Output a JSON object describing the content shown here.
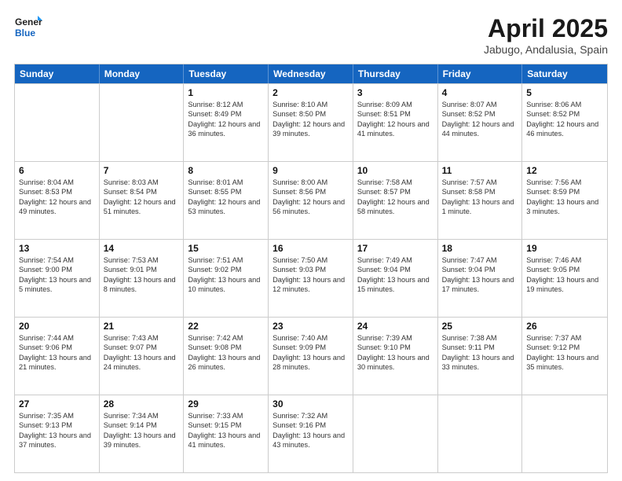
{
  "logo": {
    "line1": "General",
    "line2": "Blue"
  },
  "title": "April 2025",
  "subtitle": "Jabugo, Andalusia, Spain",
  "days": [
    "Sunday",
    "Monday",
    "Tuesday",
    "Wednesday",
    "Thursday",
    "Friday",
    "Saturday"
  ],
  "weeks": [
    [
      {
        "day": "",
        "sunrise": "",
        "sunset": "",
        "daylight": ""
      },
      {
        "day": "",
        "sunrise": "",
        "sunset": "",
        "daylight": ""
      },
      {
        "day": "1",
        "sunrise": "Sunrise: 8:12 AM",
        "sunset": "Sunset: 8:49 PM",
        "daylight": "Daylight: 12 hours and 36 minutes."
      },
      {
        "day": "2",
        "sunrise": "Sunrise: 8:10 AM",
        "sunset": "Sunset: 8:50 PM",
        "daylight": "Daylight: 12 hours and 39 minutes."
      },
      {
        "day": "3",
        "sunrise": "Sunrise: 8:09 AM",
        "sunset": "Sunset: 8:51 PM",
        "daylight": "Daylight: 12 hours and 41 minutes."
      },
      {
        "day": "4",
        "sunrise": "Sunrise: 8:07 AM",
        "sunset": "Sunset: 8:52 PM",
        "daylight": "Daylight: 12 hours and 44 minutes."
      },
      {
        "day": "5",
        "sunrise": "Sunrise: 8:06 AM",
        "sunset": "Sunset: 8:52 PM",
        "daylight": "Daylight: 12 hours and 46 minutes."
      }
    ],
    [
      {
        "day": "6",
        "sunrise": "Sunrise: 8:04 AM",
        "sunset": "Sunset: 8:53 PM",
        "daylight": "Daylight: 12 hours and 49 minutes."
      },
      {
        "day": "7",
        "sunrise": "Sunrise: 8:03 AM",
        "sunset": "Sunset: 8:54 PM",
        "daylight": "Daylight: 12 hours and 51 minutes."
      },
      {
        "day": "8",
        "sunrise": "Sunrise: 8:01 AM",
        "sunset": "Sunset: 8:55 PM",
        "daylight": "Daylight: 12 hours and 53 minutes."
      },
      {
        "day": "9",
        "sunrise": "Sunrise: 8:00 AM",
        "sunset": "Sunset: 8:56 PM",
        "daylight": "Daylight: 12 hours and 56 minutes."
      },
      {
        "day": "10",
        "sunrise": "Sunrise: 7:58 AM",
        "sunset": "Sunset: 8:57 PM",
        "daylight": "Daylight: 12 hours and 58 minutes."
      },
      {
        "day": "11",
        "sunrise": "Sunrise: 7:57 AM",
        "sunset": "Sunset: 8:58 PM",
        "daylight": "Daylight: 13 hours and 1 minute."
      },
      {
        "day": "12",
        "sunrise": "Sunrise: 7:56 AM",
        "sunset": "Sunset: 8:59 PM",
        "daylight": "Daylight: 13 hours and 3 minutes."
      }
    ],
    [
      {
        "day": "13",
        "sunrise": "Sunrise: 7:54 AM",
        "sunset": "Sunset: 9:00 PM",
        "daylight": "Daylight: 13 hours and 5 minutes."
      },
      {
        "day": "14",
        "sunrise": "Sunrise: 7:53 AM",
        "sunset": "Sunset: 9:01 PM",
        "daylight": "Daylight: 13 hours and 8 minutes."
      },
      {
        "day": "15",
        "sunrise": "Sunrise: 7:51 AM",
        "sunset": "Sunset: 9:02 PM",
        "daylight": "Daylight: 13 hours and 10 minutes."
      },
      {
        "day": "16",
        "sunrise": "Sunrise: 7:50 AM",
        "sunset": "Sunset: 9:03 PM",
        "daylight": "Daylight: 13 hours and 12 minutes."
      },
      {
        "day": "17",
        "sunrise": "Sunrise: 7:49 AM",
        "sunset": "Sunset: 9:04 PM",
        "daylight": "Daylight: 13 hours and 15 minutes."
      },
      {
        "day": "18",
        "sunrise": "Sunrise: 7:47 AM",
        "sunset": "Sunset: 9:04 PM",
        "daylight": "Daylight: 13 hours and 17 minutes."
      },
      {
        "day": "19",
        "sunrise": "Sunrise: 7:46 AM",
        "sunset": "Sunset: 9:05 PM",
        "daylight": "Daylight: 13 hours and 19 minutes."
      }
    ],
    [
      {
        "day": "20",
        "sunrise": "Sunrise: 7:44 AM",
        "sunset": "Sunset: 9:06 PM",
        "daylight": "Daylight: 13 hours and 21 minutes."
      },
      {
        "day": "21",
        "sunrise": "Sunrise: 7:43 AM",
        "sunset": "Sunset: 9:07 PM",
        "daylight": "Daylight: 13 hours and 24 minutes."
      },
      {
        "day": "22",
        "sunrise": "Sunrise: 7:42 AM",
        "sunset": "Sunset: 9:08 PM",
        "daylight": "Daylight: 13 hours and 26 minutes."
      },
      {
        "day": "23",
        "sunrise": "Sunrise: 7:40 AM",
        "sunset": "Sunset: 9:09 PM",
        "daylight": "Daylight: 13 hours and 28 minutes."
      },
      {
        "day": "24",
        "sunrise": "Sunrise: 7:39 AM",
        "sunset": "Sunset: 9:10 PM",
        "daylight": "Daylight: 13 hours and 30 minutes."
      },
      {
        "day": "25",
        "sunrise": "Sunrise: 7:38 AM",
        "sunset": "Sunset: 9:11 PM",
        "daylight": "Daylight: 13 hours and 33 minutes."
      },
      {
        "day": "26",
        "sunrise": "Sunrise: 7:37 AM",
        "sunset": "Sunset: 9:12 PM",
        "daylight": "Daylight: 13 hours and 35 minutes."
      }
    ],
    [
      {
        "day": "27",
        "sunrise": "Sunrise: 7:35 AM",
        "sunset": "Sunset: 9:13 PM",
        "daylight": "Daylight: 13 hours and 37 minutes."
      },
      {
        "day": "28",
        "sunrise": "Sunrise: 7:34 AM",
        "sunset": "Sunset: 9:14 PM",
        "daylight": "Daylight: 13 hours and 39 minutes."
      },
      {
        "day": "29",
        "sunrise": "Sunrise: 7:33 AM",
        "sunset": "Sunset: 9:15 PM",
        "daylight": "Daylight: 13 hours and 41 minutes."
      },
      {
        "day": "30",
        "sunrise": "Sunrise: 7:32 AM",
        "sunset": "Sunset: 9:16 PM",
        "daylight": "Daylight: 13 hours and 43 minutes."
      },
      {
        "day": "",
        "sunrise": "",
        "sunset": "",
        "daylight": ""
      },
      {
        "day": "",
        "sunrise": "",
        "sunset": "",
        "daylight": ""
      },
      {
        "day": "",
        "sunrise": "",
        "sunset": "",
        "daylight": ""
      }
    ]
  ]
}
